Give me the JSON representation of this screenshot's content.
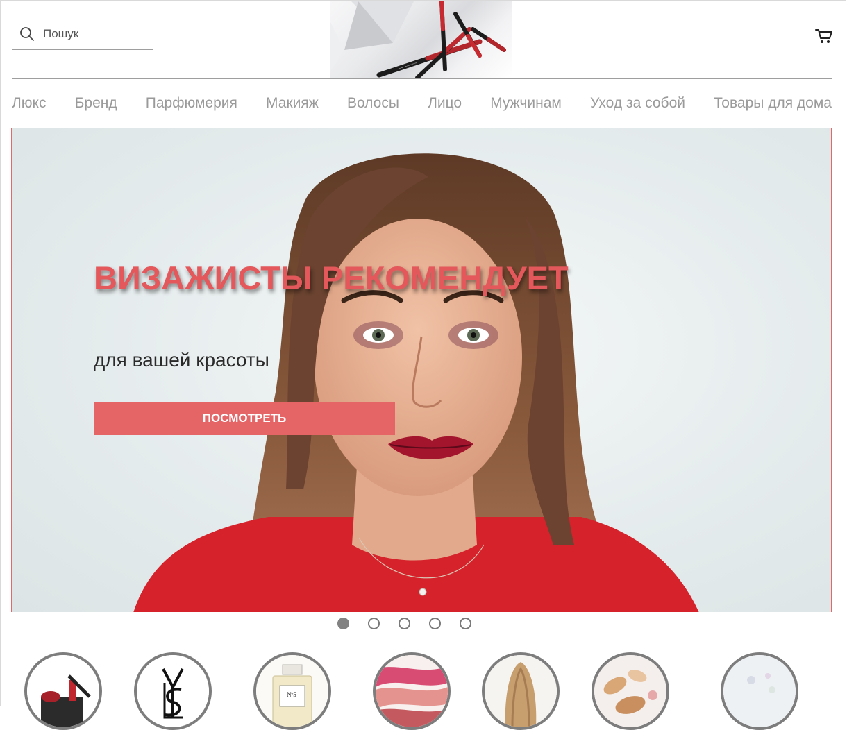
{
  "header": {
    "search_placeholder": "Пошук",
    "icons": {
      "search": "search-icon",
      "cart": "cart-icon"
    }
  },
  "nav": {
    "items": [
      "Люкс",
      "Бренд",
      "Парфюмерия",
      "Макияж",
      "Волосы",
      "Лицо",
      "Мужчинам",
      "Уход за собой",
      "Товары для дома"
    ]
  },
  "hero": {
    "title": "ВИЗАЖИСТЫ РЕКОМЕНДУЕТ",
    "subtitle": "для вашей красоты",
    "button_label": "ПОСМОТРЕТЬ"
  },
  "carousel": {
    "slide_count": 5,
    "active_index": 0
  },
  "categories": [
    {
      "image": "makeup-brushes"
    },
    {
      "image": "ysl-logo"
    },
    {
      "image": "perfume-bottle"
    },
    {
      "image": "lipstick-swatches"
    },
    {
      "image": "long-hair"
    },
    {
      "image": "foundation-swatches"
    },
    {
      "image": "home-goods"
    }
  ],
  "colors": {
    "accent": "#e56466",
    "nav_text": "#9a9a9a",
    "divider": "#9e9e9e"
  }
}
